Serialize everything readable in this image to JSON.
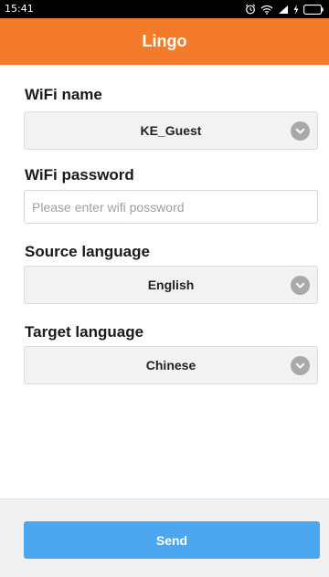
{
  "status_bar": {
    "time": "15:41",
    "icons": [
      "alarm-icon",
      "wifi-icon",
      "signal-icon",
      "charging-icon",
      "battery-icon"
    ]
  },
  "app_bar": {
    "title": "Lingo",
    "color": "#f37b29"
  },
  "form": {
    "wifi_name": {
      "label": "WiFi name",
      "value": "KE_Guest"
    },
    "wifi_password": {
      "label": "WiFi password",
      "value": "",
      "placeholder": "Please enter wifi possword"
    },
    "source_language": {
      "label": "Source language",
      "value": "English"
    },
    "target_language": {
      "label": "Target language",
      "value": "Chinese"
    }
  },
  "actions": {
    "send_label": "Send",
    "send_color": "#4aa6ee"
  }
}
